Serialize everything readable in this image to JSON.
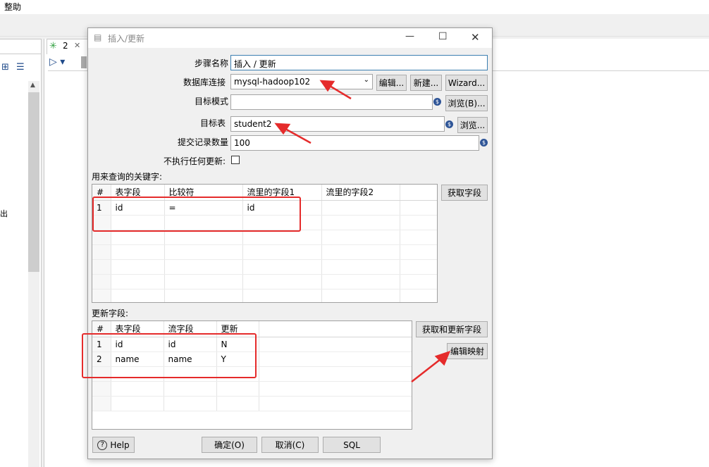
{
  "background": {
    "menu_help": "整助",
    "editor_tab_label": "2",
    "left_output": "出"
  },
  "dialog": {
    "title": "插入/更新",
    "labels": {
      "step_name": "步骤名称",
      "connection": "数据库连接",
      "target_schema": "目标模式",
      "target_table": "目标表",
      "commit_size": "提交记录数量",
      "no_update": "不执行任何更新:"
    },
    "values": {
      "step_name": "插入 / 更新",
      "connection": "mysql-hadoop102",
      "target_schema": "",
      "target_table": "student2",
      "commit_size": "100",
      "no_update_checked": false
    },
    "buttons": {
      "edit": "编辑...",
      "new": "新建...",
      "wizard": "Wizard...",
      "browse_schema": "浏览(B)...",
      "browse_table": "浏览...",
      "get_fields": "获取字段",
      "get_update_fields": "获取和更新字段",
      "edit_mapping": "编辑映射",
      "help": "Help",
      "ok": "确定(O)",
      "cancel": "取消(C)",
      "sql": "SQL"
    },
    "key_section_label": "用来查询的关键字:",
    "key_table": {
      "columns": [
        "#",
        "表字段",
        "比较符",
        "流里的字段1",
        "流里的字段2"
      ],
      "rows": [
        [
          "1",
          "id",
          "=",
          "id",
          ""
        ]
      ]
    },
    "update_section_label": "更新字段:",
    "update_table": {
      "columns": [
        "#",
        "表字段",
        "流字段",
        "更新"
      ],
      "rows": [
        [
          "1",
          "id",
          "id",
          "N"
        ],
        [
          "2",
          "name",
          "name",
          "Y"
        ]
      ]
    }
  },
  "colors": {
    "highlight_red": "#e52b2b",
    "variable_icon_blue": "#2f5597",
    "focus_blue": "#3c7fb1"
  }
}
